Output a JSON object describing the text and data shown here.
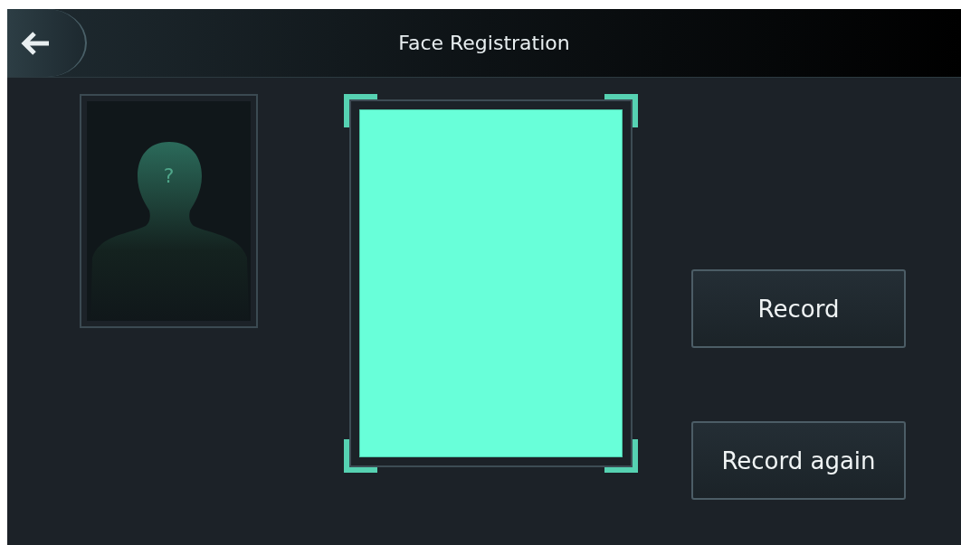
{
  "header": {
    "title": "Face Registration"
  },
  "face_photo": {
    "placeholder_mark": "?"
  },
  "camera_preview": {
    "kind": "blank"
  },
  "buttons": [
    "Record",
    "Record again"
  ]
}
